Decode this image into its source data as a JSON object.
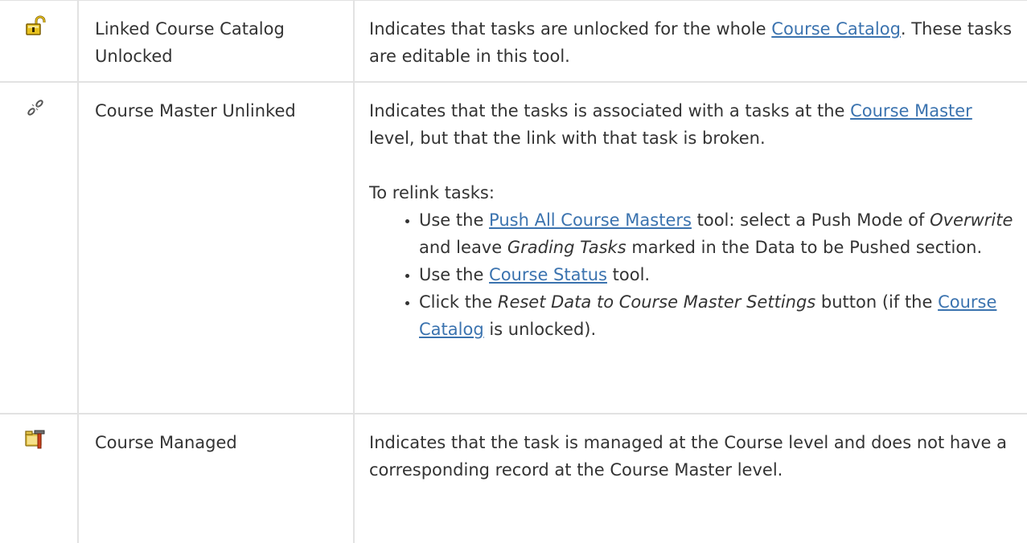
{
  "rows": [
    {
      "icon": "unlocked-padlock-icon",
      "name": "Linked Course Catalog Unlocked",
      "desc": {
        "pre": "Indicates that tasks are unlocked for the whole ",
        "link": "Course Catalog",
        "post": ". These tasks are editable in this tool."
      }
    },
    {
      "icon": "broken-chain-link-icon",
      "name": "Course Master Unlinked",
      "desc": {
        "pre": "Indicates that the tasks is associated with a tasks at the ",
        "link": "Course Master",
        "post": " level, but that the link with that task is broken."
      },
      "relink_intro": "To relink tasks:",
      "steps": [
        {
          "a": "Use the ",
          "link": "Push All Course Masters",
          "b": " tool: select a Push Mode of ",
          "em1": "Overwrite",
          "c": " and leave ",
          "em2": "Grading Tasks",
          "d": " marked in the Data to be Pushed section."
        },
        {
          "a": "Use the ",
          "link": "Course Status",
          "b": " tool."
        },
        {
          "a": "Click the ",
          "em": "Reset Data to Course Master Settings",
          "b": " button (if the ",
          "link": "Course Catalog",
          "c": " is unlocked)."
        }
      ]
    },
    {
      "icon": "course-managed-tools-icon",
      "name": "Course Managed",
      "desc": {
        "text": "Indicates that the task is managed at the Course level and does not have a corresponding record at the Course Master level."
      }
    }
  ],
  "colors": {
    "text": "#333333",
    "link": "#3b73af",
    "border": "#e2e2e2"
  }
}
